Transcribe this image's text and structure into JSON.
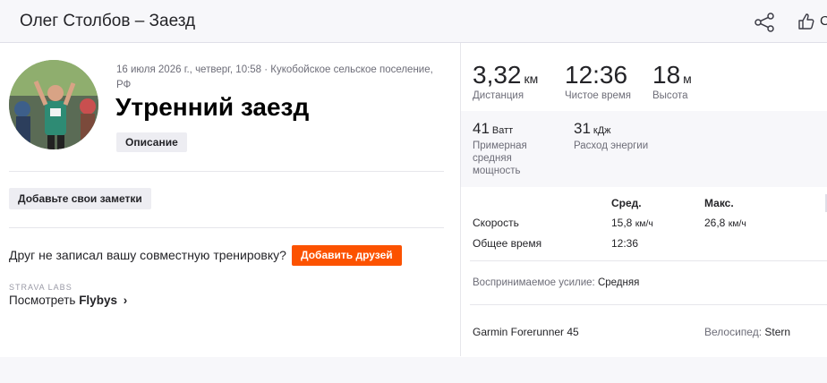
{
  "header": {
    "title": "Олег Столбов – Заезд",
    "cut_text": "С",
    "icons": [
      "share-icon",
      "thumbs-up-icon"
    ]
  },
  "activity": {
    "meta": "16 июля 2026 г., четверг, 10:58 · Кукобойское сельское поселение, РФ",
    "title": "Утренний заезд",
    "description_label": "Описание",
    "notes_label": "Добавьте свои заметки",
    "friend_question": "Друг не записал вашу совместную тренировку?",
    "add_friends_label": "Добавить друзей",
    "labs_label": "STRAVA LABS",
    "flybys_prefix": "Посмотреть ",
    "flybys_bold": "Flybys",
    "flybys_arrow": "›"
  },
  "stats": {
    "primary": [
      {
        "value": "3,32",
        "unit": "км",
        "label": "Дистанция"
      },
      {
        "value": "12:36",
        "unit": "",
        "label": "Чистое время"
      },
      {
        "value": "18",
        "unit": "м",
        "label": "Высота"
      }
    ],
    "secondary": [
      {
        "value": "41",
        "unit": "Ватт",
        "label": "Примерная средняя мощность"
      },
      {
        "value": "31",
        "unit": "кДж",
        "label": "Расход энергии"
      }
    ]
  },
  "table": {
    "headers": {
      "avg": "Сред.",
      "max": "Макс."
    },
    "rows": [
      {
        "label": "Скорость",
        "avg": "15,8",
        "avg_unit": "км/ч",
        "max": "26,8",
        "max_unit": "км/ч"
      },
      {
        "label": "Общее время",
        "avg": "12:36",
        "avg_unit": "",
        "max": "",
        "max_unit": ""
      }
    ]
  },
  "effort": {
    "label": "Воспринимаемое усилие: ",
    "value": "Средняя"
  },
  "gear": {
    "device": "Garmin Forerunner 45",
    "bike_label": "Велосипед: ",
    "bike_name": "Stern"
  },
  "colors": {
    "accent": "#fc5200",
    "background": "#f7f7fa",
    "text": "#242428",
    "muted": "#6d6d78"
  }
}
